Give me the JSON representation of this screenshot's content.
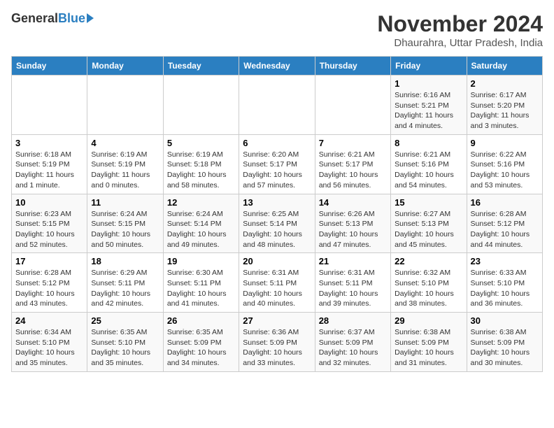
{
  "logo": {
    "general": "General",
    "blue": "Blue"
  },
  "title": "November 2024",
  "subtitle": "Dhaurahra, Uttar Pradesh, India",
  "headers": [
    "Sunday",
    "Monday",
    "Tuesday",
    "Wednesday",
    "Thursday",
    "Friday",
    "Saturday"
  ],
  "weeks": [
    [
      {
        "day": "",
        "info": ""
      },
      {
        "day": "",
        "info": ""
      },
      {
        "day": "",
        "info": ""
      },
      {
        "day": "",
        "info": ""
      },
      {
        "day": "",
        "info": ""
      },
      {
        "day": "1",
        "info": "Sunrise: 6:16 AM\nSunset: 5:21 PM\nDaylight: 11 hours and 4 minutes."
      },
      {
        "day": "2",
        "info": "Sunrise: 6:17 AM\nSunset: 5:20 PM\nDaylight: 11 hours and 3 minutes."
      }
    ],
    [
      {
        "day": "3",
        "info": "Sunrise: 6:18 AM\nSunset: 5:19 PM\nDaylight: 11 hours and 1 minute."
      },
      {
        "day": "4",
        "info": "Sunrise: 6:19 AM\nSunset: 5:19 PM\nDaylight: 11 hours and 0 minutes."
      },
      {
        "day": "5",
        "info": "Sunrise: 6:19 AM\nSunset: 5:18 PM\nDaylight: 10 hours and 58 minutes."
      },
      {
        "day": "6",
        "info": "Sunrise: 6:20 AM\nSunset: 5:17 PM\nDaylight: 10 hours and 57 minutes."
      },
      {
        "day": "7",
        "info": "Sunrise: 6:21 AM\nSunset: 5:17 PM\nDaylight: 10 hours and 56 minutes."
      },
      {
        "day": "8",
        "info": "Sunrise: 6:21 AM\nSunset: 5:16 PM\nDaylight: 10 hours and 54 minutes."
      },
      {
        "day": "9",
        "info": "Sunrise: 6:22 AM\nSunset: 5:16 PM\nDaylight: 10 hours and 53 minutes."
      }
    ],
    [
      {
        "day": "10",
        "info": "Sunrise: 6:23 AM\nSunset: 5:15 PM\nDaylight: 10 hours and 52 minutes."
      },
      {
        "day": "11",
        "info": "Sunrise: 6:24 AM\nSunset: 5:15 PM\nDaylight: 10 hours and 50 minutes."
      },
      {
        "day": "12",
        "info": "Sunrise: 6:24 AM\nSunset: 5:14 PM\nDaylight: 10 hours and 49 minutes."
      },
      {
        "day": "13",
        "info": "Sunrise: 6:25 AM\nSunset: 5:14 PM\nDaylight: 10 hours and 48 minutes."
      },
      {
        "day": "14",
        "info": "Sunrise: 6:26 AM\nSunset: 5:13 PM\nDaylight: 10 hours and 47 minutes."
      },
      {
        "day": "15",
        "info": "Sunrise: 6:27 AM\nSunset: 5:13 PM\nDaylight: 10 hours and 45 minutes."
      },
      {
        "day": "16",
        "info": "Sunrise: 6:28 AM\nSunset: 5:12 PM\nDaylight: 10 hours and 44 minutes."
      }
    ],
    [
      {
        "day": "17",
        "info": "Sunrise: 6:28 AM\nSunset: 5:12 PM\nDaylight: 10 hours and 43 minutes."
      },
      {
        "day": "18",
        "info": "Sunrise: 6:29 AM\nSunset: 5:11 PM\nDaylight: 10 hours and 42 minutes."
      },
      {
        "day": "19",
        "info": "Sunrise: 6:30 AM\nSunset: 5:11 PM\nDaylight: 10 hours and 41 minutes."
      },
      {
        "day": "20",
        "info": "Sunrise: 6:31 AM\nSunset: 5:11 PM\nDaylight: 10 hours and 40 minutes."
      },
      {
        "day": "21",
        "info": "Sunrise: 6:31 AM\nSunset: 5:11 PM\nDaylight: 10 hours and 39 minutes."
      },
      {
        "day": "22",
        "info": "Sunrise: 6:32 AM\nSunset: 5:10 PM\nDaylight: 10 hours and 38 minutes."
      },
      {
        "day": "23",
        "info": "Sunrise: 6:33 AM\nSunset: 5:10 PM\nDaylight: 10 hours and 36 minutes."
      }
    ],
    [
      {
        "day": "24",
        "info": "Sunrise: 6:34 AM\nSunset: 5:10 PM\nDaylight: 10 hours and 35 minutes."
      },
      {
        "day": "25",
        "info": "Sunrise: 6:35 AM\nSunset: 5:10 PM\nDaylight: 10 hours and 35 minutes."
      },
      {
        "day": "26",
        "info": "Sunrise: 6:35 AM\nSunset: 5:09 PM\nDaylight: 10 hours and 34 minutes."
      },
      {
        "day": "27",
        "info": "Sunrise: 6:36 AM\nSunset: 5:09 PM\nDaylight: 10 hours and 33 minutes."
      },
      {
        "day": "28",
        "info": "Sunrise: 6:37 AM\nSunset: 5:09 PM\nDaylight: 10 hours and 32 minutes."
      },
      {
        "day": "29",
        "info": "Sunrise: 6:38 AM\nSunset: 5:09 PM\nDaylight: 10 hours and 31 minutes."
      },
      {
        "day": "30",
        "info": "Sunrise: 6:38 AM\nSunset: 5:09 PM\nDaylight: 10 hours and 30 minutes."
      }
    ]
  ]
}
